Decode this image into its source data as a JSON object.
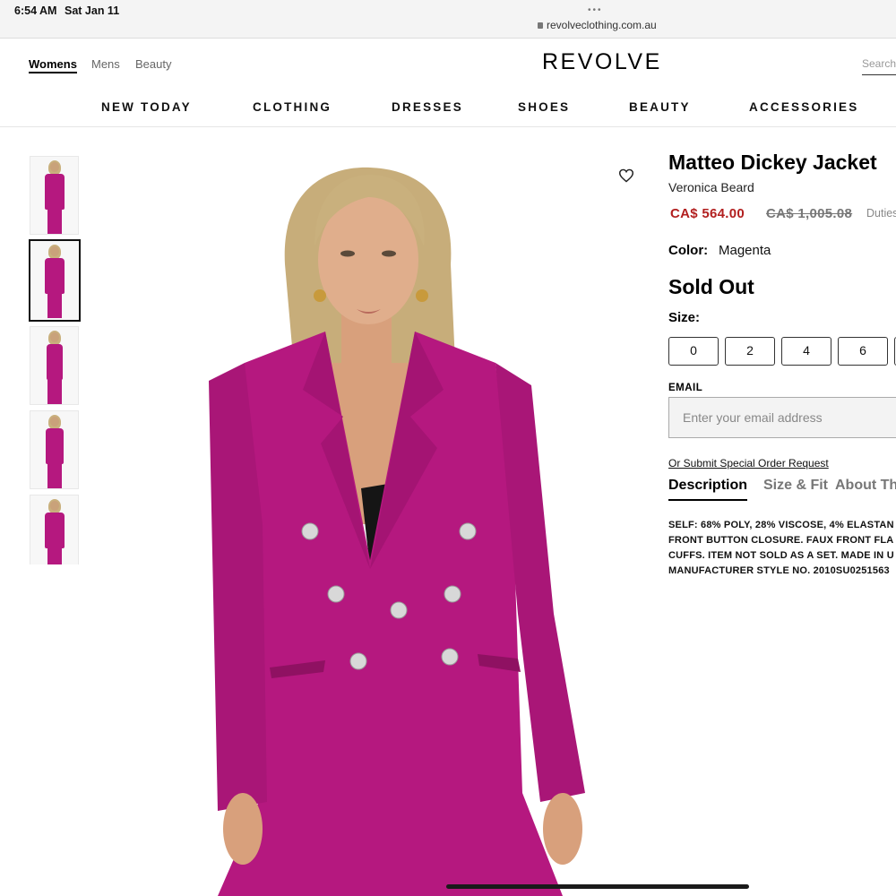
{
  "status_bar": {
    "time": "6:54 AM",
    "date": "Sat Jan 11",
    "dots": "•••",
    "url": "revolveclothing.com.au"
  },
  "header": {
    "gender_tabs": [
      "Womens",
      "Mens",
      "Beauty"
    ],
    "logo": "REVOLVE",
    "search_placeholder": "Search"
  },
  "nav": [
    "NEW TODAY",
    "CLOTHING",
    "DRESSES",
    "SHOES",
    "BEAUTY",
    "ACCESSORIES"
  ],
  "product": {
    "title": "Matteo Dickey Jacket",
    "brand": "Veronica Beard",
    "price_sale": "CA$ 564.00",
    "price_original": "CA$ 1,005.08",
    "duties_note": "Duties",
    "color_label": "Color:",
    "color_value": "Magenta",
    "availability": "Sold Out",
    "size_label": "Size:",
    "sizes": [
      "0",
      "2",
      "4",
      "6"
    ],
    "email_label": "EMAIL",
    "email_placeholder": "Enter your email address",
    "special_order": "Or Submit Special Order Request",
    "tabs": [
      "Description",
      "Size & Fit",
      "About Th"
    ],
    "description_lines": [
      "SELF: 68% POLY, 28% VISCOSE, 4% ELASTAN",
      "FRONT BUTTON CLOSURE. FAUX FRONT FLA",
      "CUFFS. ITEM NOT SOLD AS A SET. MADE IN U",
      "MANUFACTURER STYLE NO. 2010SU0251563"
    ]
  },
  "colors": {
    "accent_price": "#b21f1f",
    "product": "#b5187f"
  },
  "icons": {
    "wishlist": "heart-icon",
    "lock": "lock-icon"
  }
}
